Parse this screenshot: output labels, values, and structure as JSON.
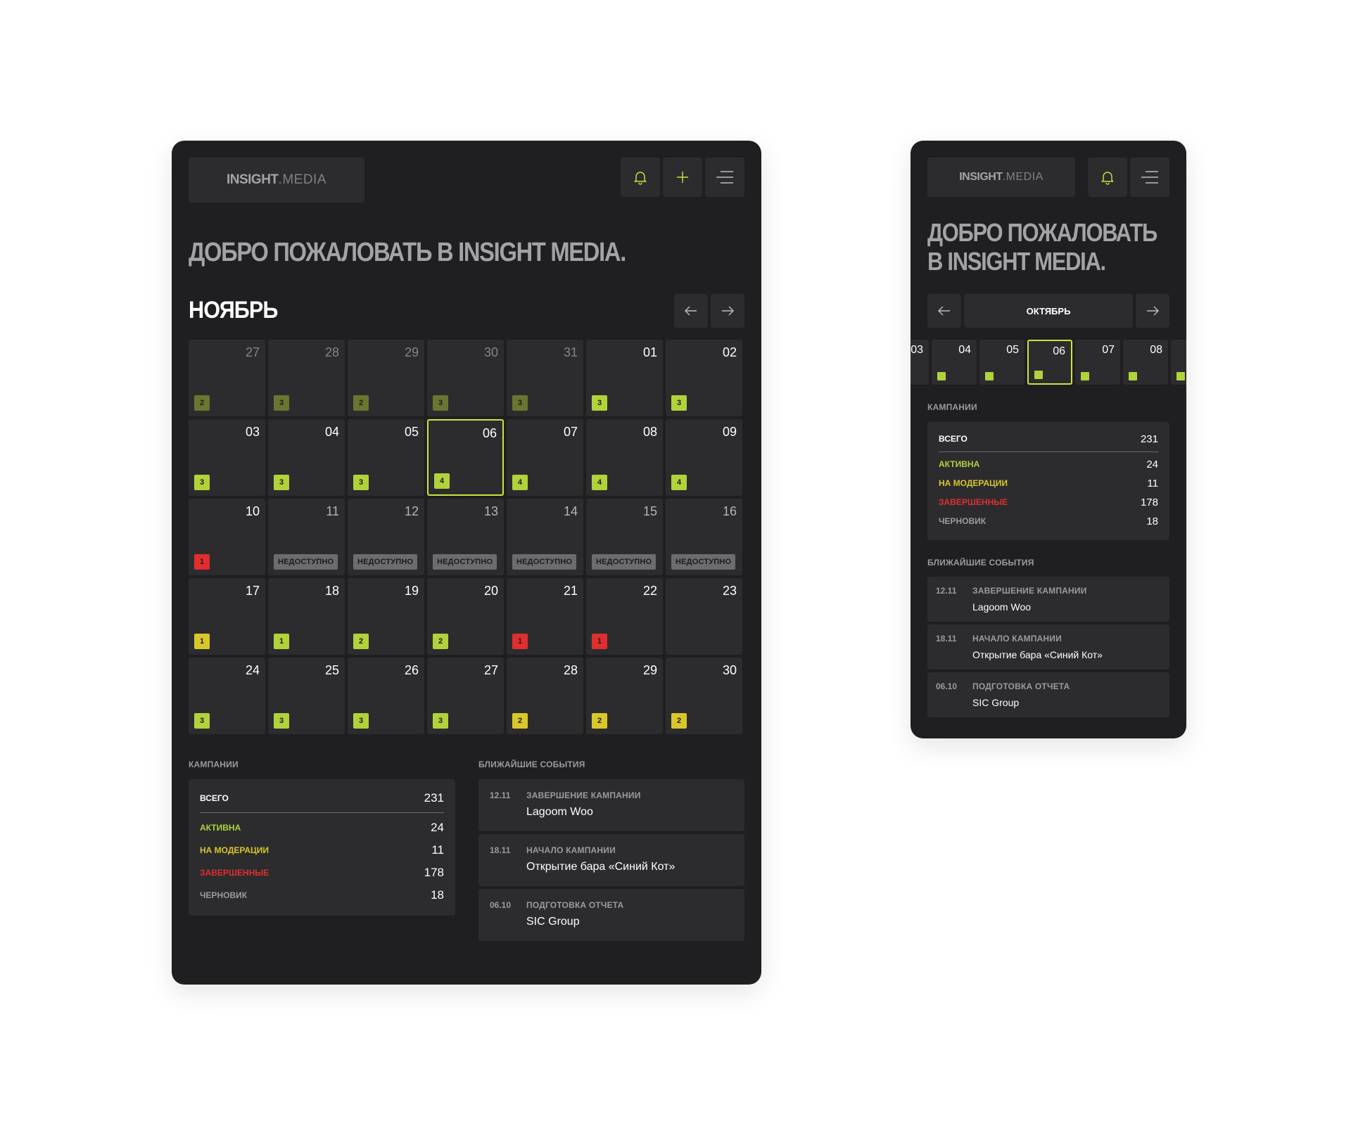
{
  "colors": {
    "green": "#b0d33a",
    "olive": "#6b7530",
    "yellow": "#d9c72a",
    "red": "#e02e2e",
    "gray": "#6b6b70",
    "selected_border": "#c8e63c"
  },
  "desktop": {
    "logo_bold": "INSIGHT",
    "logo_regular": ".MEDIA",
    "icons": [
      "bell-icon",
      "plus-icon",
      "menu-icon"
    ],
    "welcome": "ДОБРО ПОЖАЛОВАТЬ В INSIGHT MEDIA.",
    "month": "НОЯБРЬ",
    "days": [
      {
        "day": "27",
        "past": true,
        "count": "2",
        "color": "olive"
      },
      {
        "day": "28",
        "past": true,
        "count": "3",
        "color": "olive"
      },
      {
        "day": "29",
        "past": true,
        "count": "2",
        "color": "olive"
      },
      {
        "day": "30",
        "past": true,
        "count": "3",
        "color": "olive"
      },
      {
        "day": "31",
        "past": true,
        "count": "3",
        "color": "olive"
      },
      {
        "day": "01",
        "count": "3",
        "color": "green"
      },
      {
        "day": "02",
        "count": "3",
        "color": "green"
      },
      {
        "day": "03",
        "count": "3",
        "color": "green"
      },
      {
        "day": "04",
        "count": "3",
        "color": "green"
      },
      {
        "day": "05",
        "count": "3",
        "color": "green"
      },
      {
        "day": "06",
        "count": "4",
        "color": "green",
        "selected": true
      },
      {
        "day": "07",
        "count": "4",
        "color": "green"
      },
      {
        "day": "08",
        "count": "4",
        "color": "green"
      },
      {
        "day": "09",
        "count": "4",
        "color": "green"
      },
      {
        "day": "10",
        "count": "1",
        "color": "red"
      },
      {
        "day": "11",
        "unavailable": "НЕДОСТУПНО"
      },
      {
        "day": "12",
        "unavailable": "НЕДОСТУПНО"
      },
      {
        "day": "13",
        "unavailable": "НЕДОСТУПНО"
      },
      {
        "day": "14",
        "unavailable": "НЕДОСТУПНО"
      },
      {
        "day": "15",
        "unavailable": "НЕДОСТУПНО"
      },
      {
        "day": "16",
        "unavailable": "НЕДОСТУПНО"
      },
      {
        "day": "17",
        "count": "1",
        "color": "yellow"
      },
      {
        "day": "18",
        "count": "1",
        "color": "green"
      },
      {
        "day": "19",
        "count": "2",
        "color": "green"
      },
      {
        "day": "20",
        "count": "2",
        "color": "green"
      },
      {
        "day": "21",
        "count": "1",
        "color": "red"
      },
      {
        "day": "22",
        "count": "1",
        "color": "red"
      },
      {
        "day": "23"
      },
      {
        "day": "24",
        "count": "3",
        "color": "green"
      },
      {
        "day": "25",
        "count": "3",
        "color": "green"
      },
      {
        "day": "26",
        "count": "3",
        "color": "green"
      },
      {
        "day": "27",
        "count": "3",
        "color": "green"
      },
      {
        "day": "28",
        "count": "2",
        "color": "yellow"
      },
      {
        "day": "29",
        "count": "2",
        "color": "yellow"
      },
      {
        "day": "30",
        "count": "2",
        "color": "yellow"
      }
    ]
  },
  "mobile": {
    "logo_bold": "INSIGHT",
    "logo_regular": ".MEDIA",
    "icons": [
      "bell-icon",
      "menu-icon"
    ],
    "welcome_line1": "ДОБРО ПОЖАЛОВАТЬ",
    "welcome_line2": "В INSIGHT MEDIA.",
    "month": "ОКТЯБРЬ",
    "strip": [
      {
        "day": "03"
      },
      {
        "day": "04"
      },
      {
        "day": "05"
      },
      {
        "day": "06",
        "selected": true
      },
      {
        "day": "07"
      },
      {
        "day": "08"
      },
      {
        "day": ""
      }
    ]
  },
  "campaigns": {
    "title": "КАМПАНИИ",
    "total_label": "ВСЕГО",
    "total_value": "231",
    "rows": [
      {
        "label": "АКТИВНА",
        "value": "24",
        "color": "#b0d33a"
      },
      {
        "label": "НА МОДЕРАЦИИ",
        "value": "11",
        "color": "#d9c72a"
      },
      {
        "label": "ЗАВЕРШЕННЫЕ",
        "value": "178",
        "color": "#e02e2e"
      },
      {
        "label": "ЧЕРНОВИК",
        "value": "18",
        "color": "#9a9aa0"
      }
    ]
  },
  "events": {
    "title": "БЛИЖАЙШИЕ СОБЫТИЯ",
    "items": [
      {
        "date": "12.11",
        "type": "ЗАВЕРШЕНИЕ КАМПАНИИ",
        "name": "Lagoom Woo"
      },
      {
        "date": "18.11",
        "type": "НАЧАЛО КАМПАНИИ",
        "name": "Открытие бара «Синий Кот»"
      },
      {
        "date": "06.10",
        "type": "ПОДГОТОВКА ОТЧЕТА",
        "name": "SIC Group"
      }
    ]
  }
}
